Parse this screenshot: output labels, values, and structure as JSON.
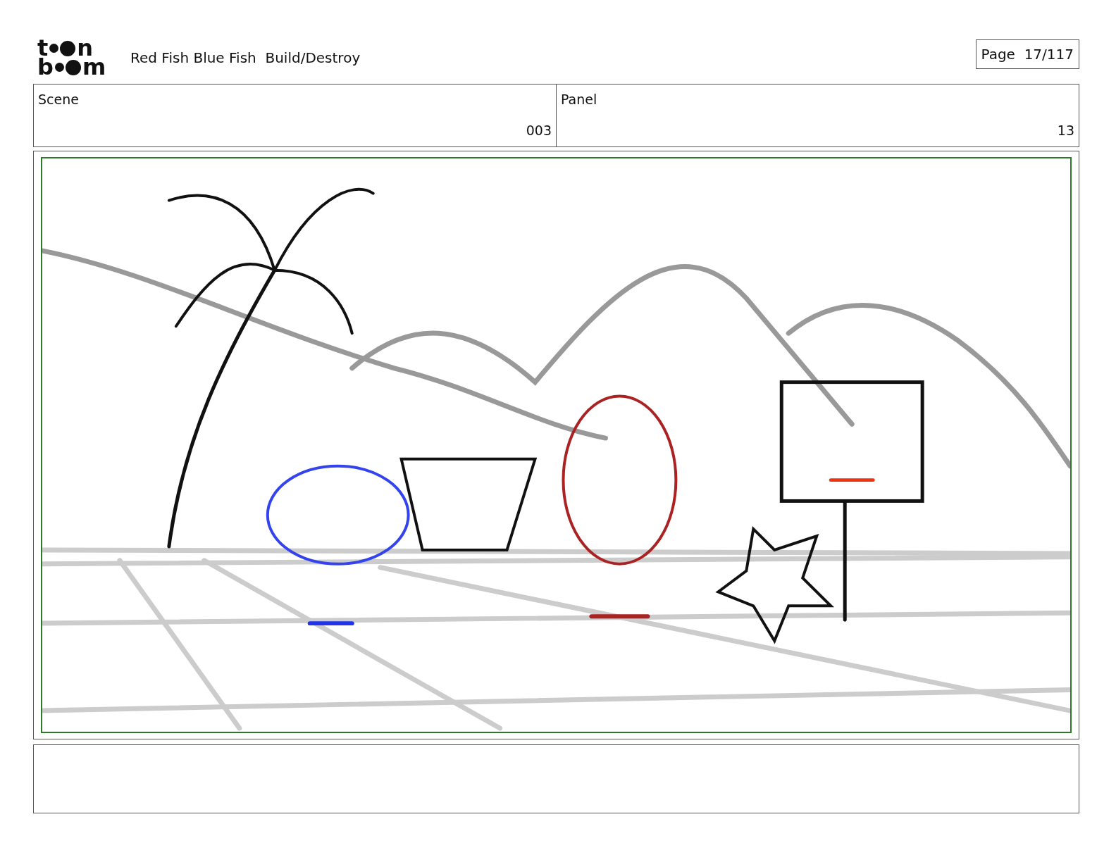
{
  "logo": [
    {
      "start": "t",
      "end": "n"
    },
    {
      "start": "b",
      "end": "m"
    }
  ],
  "title": "Red Fish Blue Fish  Build/Destroy",
  "page": "Page  17/117",
  "scene": {
    "label": "Scene",
    "value": "003"
  },
  "panel": {
    "label": "Panel",
    "value": "13"
  }
}
